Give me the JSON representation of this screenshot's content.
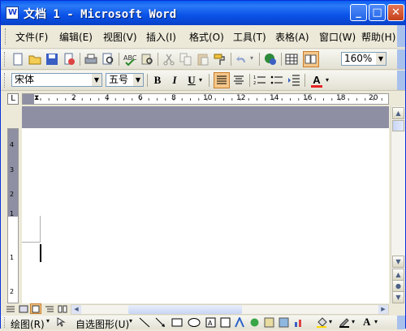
{
  "window": {
    "title": "文档 1 - Microsoft Word",
    "app_icon_letter": "W"
  },
  "title_buttons": {
    "minimize": "_",
    "maximize": "□",
    "close": "✕"
  },
  "menu": [
    "文件(F)",
    "编辑(E)",
    "视图(V)",
    "插入(I)",
    "格式(O)",
    "工具(T)",
    "表格(A)",
    "窗口(W)",
    "帮助(H)"
  ],
  "standard_toolbar": {
    "icons": [
      "new-icon",
      "open-icon",
      "save-icon",
      "permission-icon",
      "print-icon",
      "print-preview-icon",
      "spelling-icon",
      "research-icon",
      "cut-icon",
      "copy-icon",
      "paste-icon",
      "format-painter-icon",
      "undo-icon",
      "hyperlink-icon",
      "table-icon",
      "read-icon"
    ],
    "zoom": "160%"
  },
  "format_toolbar": {
    "font": "宋体",
    "size": "五号",
    "bold": "B",
    "italic": "I",
    "underline": "U",
    "font_color": "A"
  },
  "ruler": {
    "tab_selector": "L",
    "numbers": [
      "2",
      "4",
      "6",
      "8",
      "10",
      "12",
      "14",
      "16",
      "18",
      "20"
    ]
  },
  "vruler": {
    "numbers": [
      "4",
      "3",
      "2",
      "1",
      "1",
      "2"
    ]
  },
  "drawing_toolbar": {
    "draw": "绘图(R)",
    "autoshapes": "自选图形(U)",
    "font_color": "A"
  },
  "colors": {
    "titlebar": "#0a52e8",
    "page": "#ffffff",
    "gray_band": "#8f8fa4",
    "accent": "#f5c78a"
  }
}
